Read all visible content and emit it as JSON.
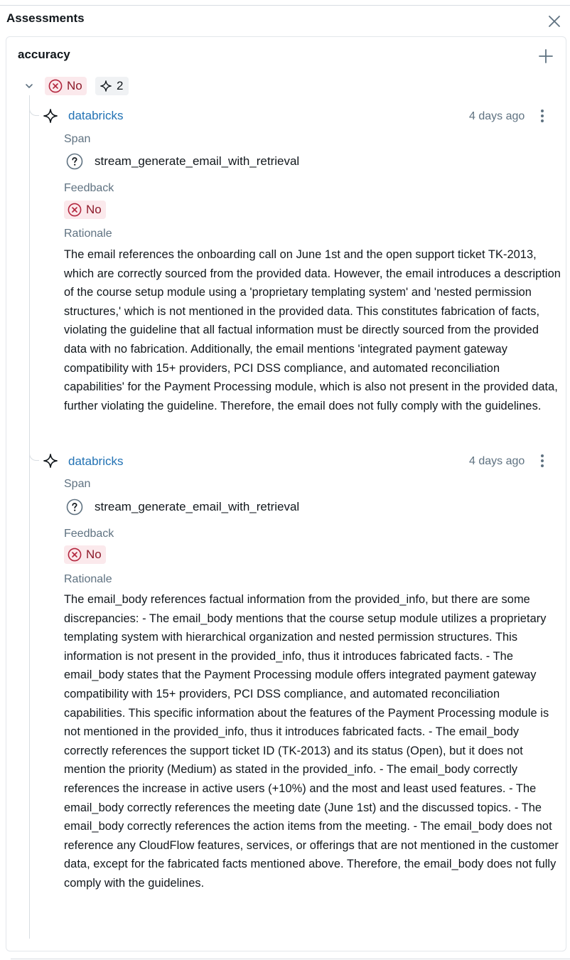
{
  "panel": {
    "title": "Assessments"
  },
  "assessment": {
    "name": "accuracy",
    "summary_value": "No",
    "count": "2",
    "items": [
      {
        "source": "databricks",
        "time": "4 days ago",
        "span_label": "Span",
        "span_name": "stream_generate_email_with_retrieval",
        "feedback_label": "Feedback",
        "feedback_value": "No",
        "rationale_label": "Rationale",
        "rationale": "The email references the onboarding call on June 1st and the open support ticket TK-2013, which are correctly sourced from the provided data. However, the email introduces a description of the course setup module using a 'proprietary templating system' and 'nested permission structures,' which is not mentioned in the provided data. This constitutes fabrication of facts, violating the guideline that all factual information must be directly sourced from the provided data with no fabrication. Additionally, the email mentions 'integrated payment gateway compatibility with 15+ providers, PCI DSS compliance, and automated reconciliation capabilities' for the Payment Processing module, which is also not present in the provided data, further violating the guideline. Therefore, the email does not fully comply with the guidelines."
      },
      {
        "source": "databricks",
        "time": "4 days ago",
        "span_label": "Span",
        "span_name": "stream_generate_email_with_retrieval",
        "feedback_label": "Feedback",
        "feedback_value": "No",
        "rationale_label": "Rationale",
        "rationale": "The email_body references factual information from the provided_info, but there are some discrepancies: - The email_body mentions that the course setup module utilizes a proprietary templating system with hierarchical organization and nested permission structures. This information is not present in the provided_info, thus it introduces fabricated facts. - The email_body states that the Payment Processing module offers integrated payment gateway compatibility with 15+ providers, PCI DSS compliance, and automated reconciliation capabilities. This specific information about the features of the Payment Processing module is not mentioned in the provided_info, thus it introduces fabricated facts. - The email_body correctly references the support ticket ID (TK-2013) and its status (Open), but it does not mention the priority (Medium) as stated in the provided_info. - The email_body correctly references the increase in active users (+10%) and the most and least used features. - The email_body correctly references the meeting date (June 1st) and the discussed topics. - The email_body correctly references the action items from the meeting. - The email_body does not reference any CloudFlow features, services, or offerings that are not mentioned in the customer data, except for the fabricated facts mentioned above. Therefore, the email_body does not fully comply with the guidelines."
      }
    ]
  },
  "colors": {
    "link": "#2272b4",
    "secondary_text": "#5f7281",
    "negative_bg": "#fbe9ec",
    "negative_fg": "#8c1a2a",
    "border": "#d8dde2"
  },
  "icons": {
    "close": "close-icon",
    "add": "plus-icon",
    "expand": "chevron-down-icon",
    "negative": "x-circle-icon",
    "ai_judge": "sparkle-icon",
    "span": "question-circle-icon",
    "menu": "kebab-menu-icon"
  }
}
